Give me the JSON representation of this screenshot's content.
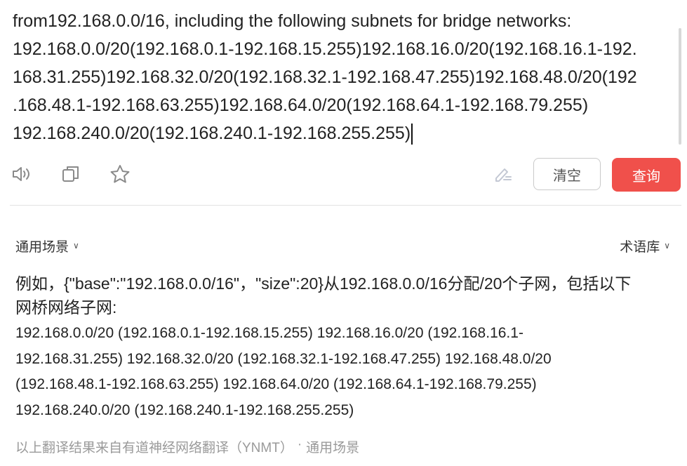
{
  "source": {
    "lines": [
      "from192.168.0.0/16, including the following subnets for bridge networks:",
      "192.168.0.0/20(192.168.0.1-192.168.15.255)192.168.16.0/20(192.168.16.1-192.",
      "168.31.255)192.168.32.0/20(192.168.32.1-192.168.47.255)192.168.48.0/20(192",
      ".168.48.1-192.168.63.255)192.168.64.0/20(192.168.64.1-192.168.79.255)",
      "192.168.240.0/20(192.168.240.1-192.168.255.255)"
    ]
  },
  "toolbar": {
    "speaker_icon": "speaker-icon",
    "copy_icon": "copy-icon",
    "star_icon": "star-icon",
    "edit_icon": "edit-icon",
    "clear_label": "清空",
    "query_label": "查询"
  },
  "colors": {
    "accent": "#f0504b",
    "divider": "#e3e3e3",
    "footer_text": "#9a9a9a"
  },
  "options": {
    "scene_label": "通用场景",
    "term_label": "术语库"
  },
  "result": {
    "head_lines": [
      "例如，{\"base\":\"192.168.0.0/16\"，\"size\":20}从192.168.0.0/16分配/20个子网，包括以下",
      "网桥网络子网:"
    ],
    "body_lines": [
      "192.168.0.0/20 (192.168.0.1-192.168.15.255) 192.168.16.0/20 (192.168.16.1-",
      "192.168.31.255) 192.168.32.0/20 (192.168.32.1-192.168.47.255) 192.168.48.0/20",
      "(192.168.48.1-192.168.63.255) 192.168.64.0/20 (192.168.64.1-192.168.79.255)",
      "192.168.240.0/20 (192.168.240.1-192.168.255.255)"
    ]
  },
  "footer": {
    "note": "以上翻译结果来自有道神经网络翻译（YNMT）",
    "separator": "·",
    "scene": "通用场景"
  }
}
